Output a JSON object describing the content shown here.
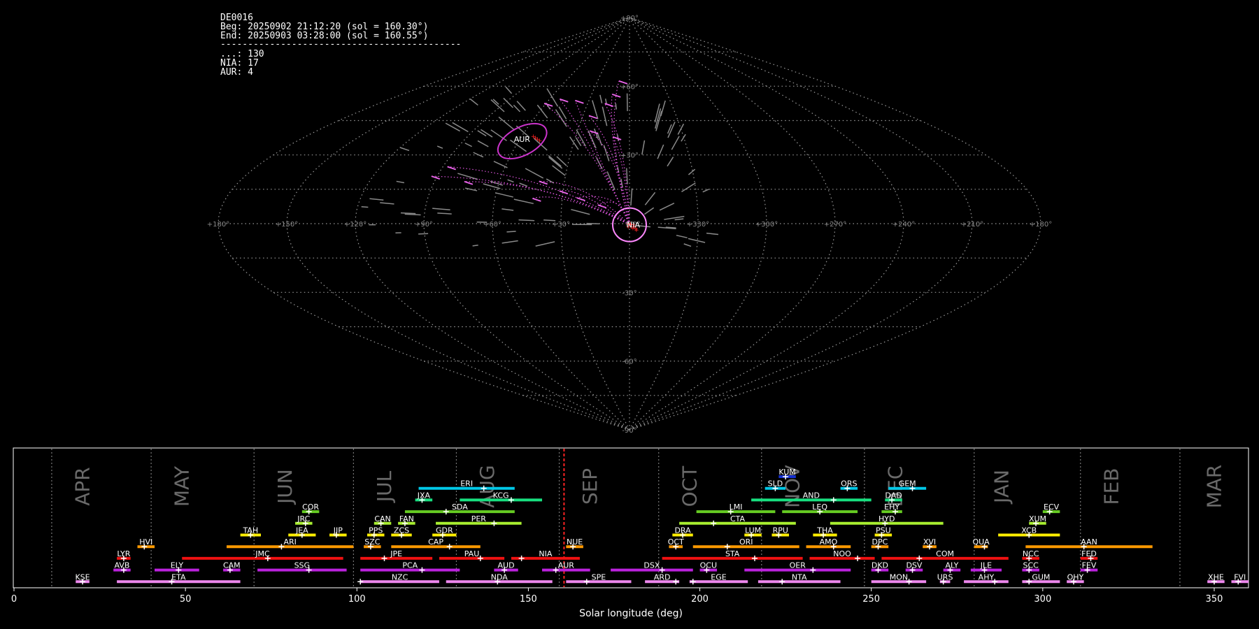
{
  "info": {
    "station": "DE0016",
    "beg": "Beg: 20250902 21:12:20 (sol = 160.30°)",
    "end": "End: 20250903 03:28:00 (sol = 160.55°)",
    "sep": "--------------------------------------------",
    "counts": [
      "...: 130",
      "NIA: 17",
      "AUR: 4"
    ]
  },
  "chart_data": [
    {
      "type": "scatter",
      "title": "",
      "projection": "sinusoidal",
      "grid": true,
      "lon_labels": [
        "+180°",
        "+150°",
        "+120°",
        "+90°",
        "+60°",
        "+30°",
        "0°",
        "+330°",
        "+300°",
        "+270°",
        "+240°",
        "+210°",
        "+180°"
      ],
      "lat_labels": [
        "+90°",
        "+60°",
        "+30°",
        "0°",
        "-30°",
        "-60°",
        "-90°"
      ],
      "highlighted_radiants": [
        {
          "name": "AUR",
          "color": "#cc33cc"
        },
        {
          "name": "NIA",
          "color": "#ff88ff"
        }
      ]
    },
    {
      "type": "timeline",
      "xlabel": "Solar longitude (deg)",
      "xlim": [
        0,
        360
      ],
      "xticks": [
        "0",
        "50",
        "100",
        "150",
        "200",
        "250",
        "300",
        "350"
      ],
      "current_sol": 160.4,
      "months": [
        {
          "name": "APR",
          "sol": 20
        },
        {
          "name": "MAY",
          "sol": 49
        },
        {
          "name": "JUN",
          "sol": 79
        },
        {
          "name": "JUL",
          "sol": 108
        },
        {
          "name": "AUG",
          "sol": 138
        },
        {
          "name": "SEP",
          "sol": 168
        },
        {
          "name": "OCT",
          "sol": 197
        },
        {
          "name": "NOV",
          "sol": 227
        },
        {
          "name": "DEC",
          "sol": 257
        },
        {
          "name": "JAN",
          "sol": 288
        },
        {
          "name": "FEB",
          "sol": 320
        },
        {
          "name": "MAR",
          "sol": 350
        }
      ],
      "month_dividers": [
        11,
        40,
        70,
        99,
        129,
        159,
        188,
        218,
        248,
        280,
        311,
        340
      ],
      "showers": [
        {
          "code": "KUM",
          "start": 223,
          "end": 228,
          "peak": 225,
          "row": 0,
          "color": "#1530d0"
        },
        {
          "code": "ERI",
          "start": 118,
          "end": 146,
          "peak": 137,
          "row": 1,
          "color": "#00c8e8"
        },
        {
          "code": "SLD",
          "start": 219,
          "end": 225,
          "peak": 222,
          "row": 1,
          "color": "#00c8e8"
        },
        {
          "code": "ORS",
          "start": 241,
          "end": 246,
          "peak": 243,
          "row": 1,
          "color": "#00c8e8"
        },
        {
          "code": "GEM",
          "start": 255,
          "end": 266,
          "peak": 262,
          "row": 1,
          "color": "#00c8e8"
        },
        {
          "code": "JXA",
          "start": 117,
          "end": 122,
          "peak": 119,
          "row": 2,
          "color": "#18e080"
        },
        {
          "code": "KCG",
          "start": 130,
          "end": 154,
          "peak": 145,
          "row": 2,
          "color": "#18e080"
        },
        {
          "code": "AND",
          "start": 215,
          "end": 250,
          "peak": 239,
          "row": 2,
          "color": "#18e080"
        },
        {
          "code": "DAD",
          "start": 254,
          "end": 259,
          "peak": 256,
          "row": 2,
          "color": "#18e080"
        },
        {
          "code": "COR",
          "start": 84,
          "end": 89,
          "peak": 86,
          "row": 3,
          "color": "#66cc22"
        },
        {
          "code": "SDA",
          "start": 114,
          "end": 146,
          "peak": 126,
          "row": 3,
          "color": "#66cc22"
        },
        {
          "code": "LMI",
          "start": 199,
          "end": 222,
          "peak": 209,
          "row": 3,
          "color": "#66cc22"
        },
        {
          "code": "LEQ",
          "start": 224,
          "end": 246,
          "peak": 235,
          "row": 3,
          "color": "#66cc22"
        },
        {
          "code": "EHY",
          "start": 253,
          "end": 259,
          "peak": 257,
          "row": 3,
          "color": "#66cc22"
        },
        {
          "code": "ECV",
          "start": 300,
          "end": 305,
          "peak": 302,
          "row": 3,
          "color": "#66cc22"
        },
        {
          "code": "JRC",
          "start": 82,
          "end": 87,
          "peak": 85,
          "row": 4,
          "color": "#a8ee30"
        },
        {
          "code": "CAN",
          "start": 105,
          "end": 110,
          "peak": 107,
          "row": 4,
          "color": "#a8ee30"
        },
        {
          "code": "FAN",
          "start": 112,
          "end": 117,
          "peak": 114,
          "row": 4,
          "color": "#a8ee30"
        },
        {
          "code": "PER",
          "start": 123,
          "end": 148,
          "peak": 140,
          "row": 4,
          "color": "#a8ee30"
        },
        {
          "code": "CTA",
          "start": 194,
          "end": 228,
          "peak": 204,
          "row": 4,
          "color": "#a8ee30"
        },
        {
          "code": "HYD",
          "start": 238,
          "end": 271,
          "peak": 254,
          "row": 4,
          "color": "#a8ee30"
        },
        {
          "code": "XUM",
          "start": 296,
          "end": 301,
          "peak": 298,
          "row": 4,
          "color": "#a8ee30"
        },
        {
          "code": "TAH",
          "start": 66,
          "end": 72,
          "peak": 69,
          "row": 5,
          "color": "#ffee00"
        },
        {
          "code": "JEA",
          "start": 80,
          "end": 88,
          "peak": 84,
          "row": 5,
          "color": "#ffee00"
        },
        {
          "code": "JIP",
          "start": 92,
          "end": 97,
          "peak": 94,
          "row": 5,
          "color": "#ffee00"
        },
        {
          "code": "PPS",
          "start": 103,
          "end": 108,
          "peak": 105,
          "row": 5,
          "color": "#ffee00"
        },
        {
          "code": "ZCS",
          "start": 110,
          "end": 116,
          "peak": 113,
          "row": 5,
          "color": "#ffee00"
        },
        {
          "code": "GDR",
          "start": 122,
          "end": 129,
          "peak": 125,
          "row": 5,
          "color": "#ffee00"
        },
        {
          "code": "DRA",
          "start": 192,
          "end": 198,
          "peak": 195,
          "row": 5,
          "color": "#ffee00"
        },
        {
          "code": "LUM",
          "start": 213,
          "end": 218,
          "peak": 215,
          "row": 5,
          "color": "#ffee00"
        },
        {
          "code": "RPU",
          "start": 221,
          "end": 226,
          "peak": 223,
          "row": 5,
          "color": "#ffee00"
        },
        {
          "code": "THA",
          "start": 233,
          "end": 240,
          "peak": 236,
          "row": 5,
          "color": "#ffee00"
        },
        {
          "code": "PSU",
          "start": 251,
          "end": 256,
          "peak": 253,
          "row": 5,
          "color": "#ffee00"
        },
        {
          "code": "XCB",
          "start": 287,
          "end": 305,
          "peak": 296,
          "row": 5,
          "color": "#ffee00"
        },
        {
          "code": "HVI",
          "start": 36,
          "end": 41,
          "peak": 38,
          "row": 6,
          "color": "#ff9900"
        },
        {
          "code": "ARI",
          "start": 62,
          "end": 99,
          "peak": 78,
          "row": 6,
          "color": "#ff9900"
        },
        {
          "code": "SZC",
          "start": 102,
          "end": 107,
          "peak": 104,
          "row": 6,
          "color": "#ff9900"
        },
        {
          "code": "CAP",
          "start": 110,
          "end": 136,
          "peak": 127,
          "row": 6,
          "color": "#ff9900"
        },
        {
          "code": "NUE",
          "start": 161,
          "end": 166,
          "peak": 163,
          "row": 6,
          "color": "#ff9900"
        },
        {
          "code": "OCT",
          "start": 191,
          "end": 195,
          "peak": 193,
          "row": 6,
          "color": "#ff9900"
        },
        {
          "code": "ORI",
          "start": 198,
          "end": 229,
          "peak": 208,
          "row": 6,
          "color": "#ff9900"
        },
        {
          "code": "AMO",
          "start": 231,
          "end": 244,
          "peak": 239,
          "row": 6,
          "color": "#ff9900"
        },
        {
          "code": "DPC",
          "start": 250,
          "end": 255,
          "peak": 252,
          "row": 6,
          "color": "#ff9900"
        },
        {
          "code": "XVI",
          "start": 265,
          "end": 269,
          "peak": 267,
          "row": 6,
          "color": "#ff9900"
        },
        {
          "code": "QUA",
          "start": 280,
          "end": 284,
          "peak": 283,
          "row": 6,
          "color": "#ff9900"
        },
        {
          "code": "AAN",
          "start": 295,
          "end": 332,
          "peak": 312,
          "row": 6,
          "color": "#ff9900"
        },
        {
          "code": "LYR",
          "start": 30,
          "end": 34,
          "peak": 32,
          "row": 7,
          "color": "#ee1111"
        },
        {
          "code": "JMC",
          "start": 49,
          "end": 96,
          "peak": 74,
          "row": 7,
          "color": "#ee1111"
        },
        {
          "code": "JPE",
          "start": 101,
          "end": 122,
          "peak": 108,
          "row": 7,
          "color": "#ee1111"
        },
        {
          "code": "PAU",
          "start": 124,
          "end": 143,
          "peak": 136,
          "row": 7,
          "color": "#ee1111"
        },
        {
          "code": "NIA",
          "start": 145,
          "end": 165,
          "peak": 148,
          "row": 7,
          "color": "#ee1111"
        },
        {
          "code": "STA",
          "start": 189,
          "end": 230,
          "peak": 216,
          "row": 7,
          "color": "#ee1111"
        },
        {
          "code": "NOO",
          "start": 232,
          "end": 251,
          "peak": 246,
          "row": 7,
          "color": "#ee1111"
        },
        {
          "code": "COM",
          "start": 253,
          "end": 290,
          "peak": 264,
          "row": 7,
          "color": "#ee1111"
        },
        {
          "code": "NCC",
          "start": 294,
          "end": 299,
          "peak": 296,
          "row": 7,
          "color": "#ee1111"
        },
        {
          "code": "FED",
          "start": 311,
          "end": 316,
          "peak": 314,
          "row": 7,
          "color": "#ee1111"
        },
        {
          "code": "AVB",
          "start": 29,
          "end": 34,
          "peak": 32,
          "row": 8,
          "color": "#bb22dd"
        },
        {
          "code": "ELY",
          "start": 41,
          "end": 54,
          "peak": 48,
          "row": 8,
          "color": "#bb22dd"
        },
        {
          "code": "CAM",
          "start": 61,
          "end": 66,
          "peak": 63,
          "row": 8,
          "color": "#bb22dd"
        },
        {
          "code": "SSG",
          "start": 71,
          "end": 97,
          "peak": 86,
          "row": 8,
          "color": "#bb22dd"
        },
        {
          "code": "PCA",
          "start": 101,
          "end": 130,
          "peak": 119,
          "row": 8,
          "color": "#bb22dd"
        },
        {
          "code": "AUD",
          "start": 140,
          "end": 147,
          "peak": 143,
          "row": 8,
          "color": "#bb22dd"
        },
        {
          "code": "AUR",
          "start": 154,
          "end": 168,
          "peak": 158,
          "row": 8,
          "color": "#bb22dd"
        },
        {
          "code": "DSX",
          "start": 174,
          "end": 198,
          "peak": 189,
          "row": 8,
          "color": "#bb22dd"
        },
        {
          "code": "OCU",
          "start": 200,
          "end": 205,
          "peak": 202,
          "row": 8,
          "color": "#bb22dd"
        },
        {
          "code": "OER",
          "start": 213,
          "end": 244,
          "peak": 233,
          "row": 8,
          "color": "#bb22dd"
        },
        {
          "code": "DKD",
          "start": 250,
          "end": 255,
          "peak": 252,
          "row": 8,
          "color": "#bb22dd"
        },
        {
          "code": "DSV",
          "start": 260,
          "end": 265,
          "peak": 262,
          "row": 8,
          "color": "#bb22dd"
        },
        {
          "code": "ALY",
          "start": 271,
          "end": 276,
          "peak": 273,
          "row": 8,
          "color": "#bb22dd"
        },
        {
          "code": "JLE",
          "start": 279,
          "end": 288,
          "peak": 283,
          "row": 8,
          "color": "#bb22dd"
        },
        {
          "code": "SCC",
          "start": 294,
          "end": 299,
          "peak": 296,
          "row": 8,
          "color": "#bb22dd"
        },
        {
          "code": "FEV",
          "start": 311,
          "end": 316,
          "peak": 313,
          "row": 8,
          "color": "#bb22dd"
        },
        {
          "code": "KSE",
          "start": 18,
          "end": 22,
          "peak": 20,
          "row": 9,
          "color": "#ee88ee"
        },
        {
          "code": "ETA",
          "start": 30,
          "end": 66,
          "peak": 46,
          "row": 9,
          "color": "#ee88ee"
        },
        {
          "code": "NZC",
          "start": 101,
          "end": 124,
          "peak": 101,
          "row": 9,
          "color": "#ee88ee"
        },
        {
          "code": "NDA",
          "start": 126,
          "end": 157,
          "peak": 141,
          "row": 9,
          "color": "#ee88ee"
        },
        {
          "code": "SPE",
          "start": 161,
          "end": 180,
          "peak": 167,
          "row": 9,
          "color": "#ee88ee"
        },
        {
          "code": "ARD",
          "start": 184,
          "end": 194,
          "peak": 193,
          "row": 9,
          "color": "#ee88ee"
        },
        {
          "code": "EGE",
          "start": 197,
          "end": 214,
          "peak": 198,
          "row": 9,
          "color": "#ee88ee"
        },
        {
          "code": "NTA",
          "start": 217,
          "end": 241,
          "peak": 224,
          "row": 9,
          "color": "#ee88ee"
        },
        {
          "code": "MON",
          "start": 250,
          "end": 266,
          "peak": 261,
          "row": 9,
          "color": "#ee88ee"
        },
        {
          "code": "URS",
          "start": 270,
          "end": 273,
          "peak": 271,
          "row": 9,
          "color": "#ee88ee"
        },
        {
          "code": "AHY",
          "start": 277,
          "end": 290,
          "peak": 286,
          "row": 9,
          "color": "#ee88ee"
        },
        {
          "code": "GUM",
          "start": 294,
          "end": 305,
          "peak": 296,
          "row": 9,
          "color": "#ee88ee"
        },
        {
          "code": "OHY",
          "start": 307,
          "end": 312,
          "peak": 309,
          "row": 9,
          "color": "#ee88ee"
        },
        {
          "code": "XHE",
          "start": 348,
          "end": 353,
          "peak": 350,
          "row": 9,
          "color": "#ee88ee"
        },
        {
          "code": "FVI",
          "start": 355,
          "end": 360,
          "peak": 357,
          "row": 9,
          "color": "#ee88ee"
        }
      ]
    }
  ]
}
